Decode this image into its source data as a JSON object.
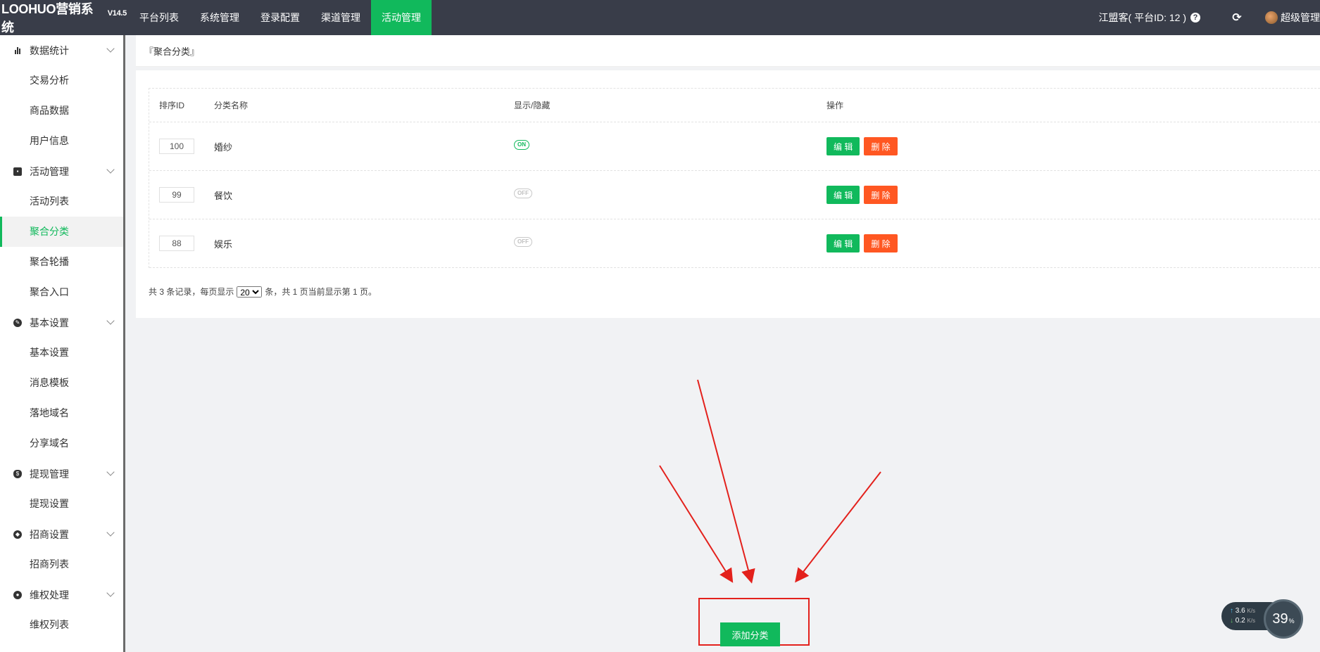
{
  "brand": {
    "name": "LOOHUO营销系统",
    "version": "V14.5"
  },
  "top_nav": [
    {
      "label": "平台列表",
      "active": false
    },
    {
      "label": "系统管理",
      "active": false
    },
    {
      "label": "登录配置",
      "active": false
    },
    {
      "label": "渠道管理",
      "active": false
    },
    {
      "label": "活动管理",
      "active": true
    }
  ],
  "top_right": {
    "platform": "江盟客( 平台ID: 12 )",
    "user": "超级管理"
  },
  "sidebar": [
    {
      "group": "数据统计",
      "icon": "bar-chart-icon",
      "items": [
        "交易分析",
        "商品数据",
        "用户信息"
      ]
    },
    {
      "group": "活动管理",
      "icon": "bag-icon",
      "items": [
        "活动列表",
        "聚合分类",
        "聚合轮播",
        "聚合入口"
      ]
    },
    {
      "group": "基本设置",
      "icon": "settings-icon",
      "items": [
        "基本设置",
        "消息模板",
        "落地域名",
        "分享域名"
      ]
    },
    {
      "group": "提现管理",
      "icon": "money-bag-icon",
      "items": [
        "提现设置"
      ]
    },
    {
      "group": "招商设置",
      "icon": "compass-icon",
      "items": [
        "招商列表"
      ]
    },
    {
      "group": "维权处理",
      "icon": "shield-icon",
      "items": [
        "维权列表"
      ]
    }
  ],
  "sidebar_active": "聚合分类",
  "breadcrumb": "『聚合分类』",
  "table": {
    "headers": {
      "id": "排序ID",
      "name": "分类名称",
      "show": "显示/隐藏",
      "op": "操作"
    },
    "rows": [
      {
        "sort": "100",
        "name": "婚纱",
        "switch": "ON"
      },
      {
        "sort": "99",
        "name": "餐饮",
        "switch": "OFF"
      },
      {
        "sort": "88",
        "name": "娱乐",
        "switch": "OFF"
      }
    ],
    "edit_label": "编 辑",
    "delete_label": "删 除"
  },
  "pager": {
    "prefix": "共 3 条记录，每页显示",
    "page_size": "20",
    "suffix": "条，共 1 页当前显示第 1 页。"
  },
  "add_button": "添加分类",
  "speed_widget": {
    "up": "3.6",
    "down": "0.2",
    "unit": "K/s",
    "percent": "39",
    "percent_sign": "%"
  },
  "colors": {
    "topbar": "#393d49",
    "accent": "#11b95c",
    "danger": "#ff5722",
    "annotation": "#e3211c"
  }
}
